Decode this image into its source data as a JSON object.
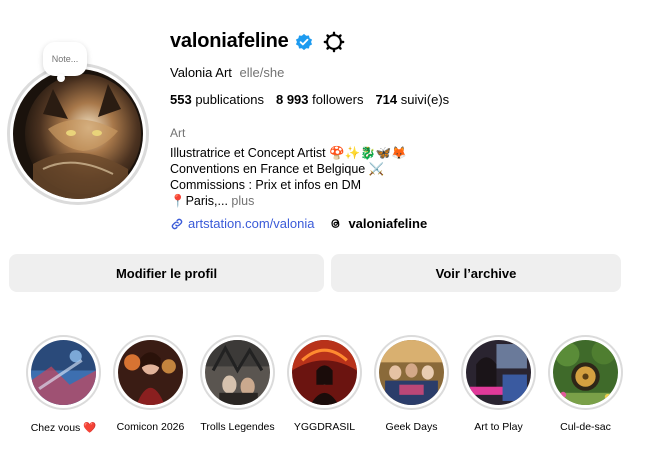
{
  "profile": {
    "note_label": "Note...",
    "username": "valoniafeline",
    "display_name": "Valonia Art",
    "pronouns": "elle/she",
    "verified_color": "#1d9bf0",
    "stats": {
      "posts_count": "553",
      "posts_label": "publications",
      "followers_count": "8 993",
      "followers_label": "followers",
      "following_count": "714",
      "following_label": "suivi(e)s"
    },
    "category": "Art",
    "bio": {
      "line1": "Illustratrice et Concept Artist 🍄✨🐉🦋🦊",
      "line2": "Conventions en France et Belgique ⚔️",
      "line3": "Commissions : Prix et infos en DM",
      "line4": "📍Paris,...",
      "more": "plus"
    },
    "link": "artstation.com/valonia",
    "threads_handle": "valoniafeline"
  },
  "actions": {
    "edit_profile": "Modifier le profil",
    "view_archive": "Voir l’archive"
  },
  "highlights": [
    {
      "label": "Chez vous",
      "suffix": "❤️"
    },
    {
      "label": "Comicon 2026"
    },
    {
      "label": "Trolls Legendes"
    },
    {
      "label": "YGGDRASIL"
    },
    {
      "label": "Geek Days"
    },
    {
      "label": "Art to Play"
    },
    {
      "label": "Cul-de-sac"
    }
  ]
}
